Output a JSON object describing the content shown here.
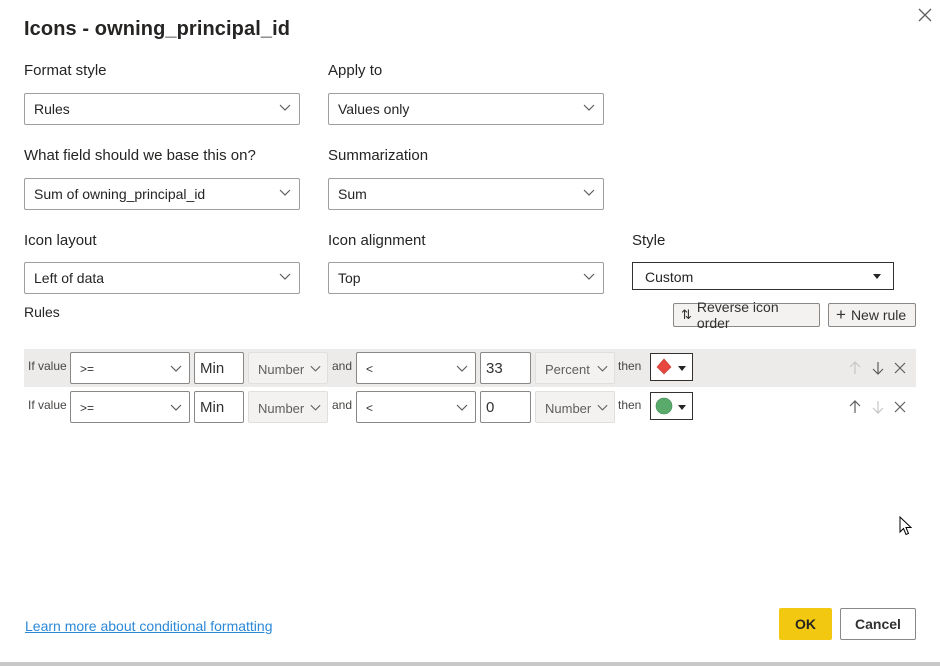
{
  "dialog": {
    "title": "Icons - owning_principal_id",
    "close_icon": "close-icon"
  },
  "fields": {
    "format_style": {
      "label": "Format style",
      "value": "Rules"
    },
    "apply_to": {
      "label": "Apply to",
      "value": "Values only"
    },
    "base_field": {
      "label": "What field should we base this on?",
      "value": "Sum of owning_principal_id"
    },
    "summarization": {
      "label": "Summarization",
      "value": "Sum"
    },
    "icon_layout": {
      "label": "Icon layout",
      "value": "Left of data"
    },
    "icon_alignment": {
      "label": "Icon alignment",
      "value": "Top"
    },
    "style": {
      "label": "Style",
      "value": "Custom"
    }
  },
  "rules": {
    "label": "Rules",
    "reverse_button": {
      "label": "Reverse icon order",
      "icon": "reverse-arrows-icon"
    },
    "new_rule_button": {
      "label": "New rule",
      "icon": "plus-icon"
    },
    "rows": [
      {
        "if_label": "If value",
        "operator1": ">=",
        "value1": "Min",
        "type1": "Number",
        "and_label": "and",
        "operator2": "<",
        "value2": "33",
        "type2": "Percent",
        "then_label": "then",
        "icon": "red-diamond-icon",
        "icon_color": "#e8473e",
        "move_up_enabled": false,
        "move_down_enabled": true
      },
      {
        "if_label": "If value",
        "operator1": ">=",
        "value1": "Min",
        "type1": "Number",
        "and_label": "and",
        "operator2": "<",
        "value2": "0",
        "type2": "Number",
        "then_label": "then",
        "icon": "green-circle-icon",
        "icon_color": "#5aab6b",
        "move_up_enabled": true,
        "move_down_enabled": false
      }
    ]
  },
  "footer": {
    "learn_more_link": "Learn more about conditional formatting",
    "ok_label": "OK",
    "cancel_label": "Cancel"
  },
  "colors": {
    "primary_button": "#f2c811",
    "link": "#2b88d8",
    "row_highlight": "#edebe9"
  }
}
